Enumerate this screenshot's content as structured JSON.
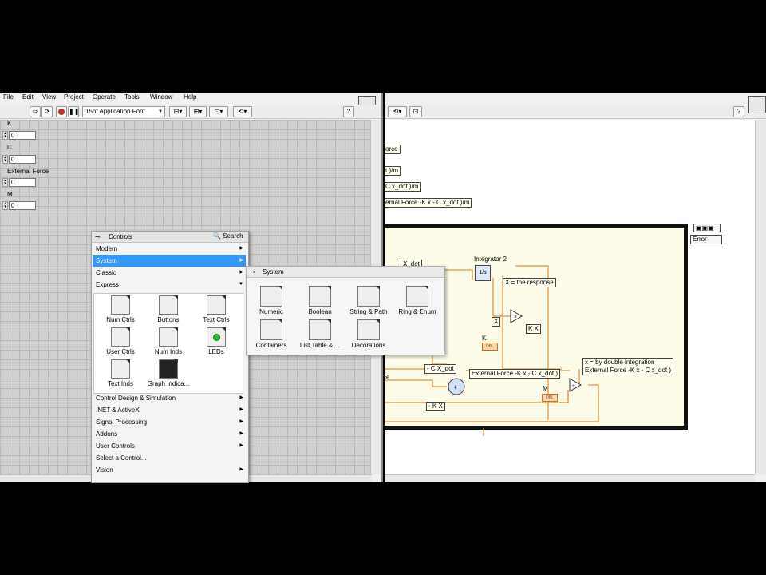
{
  "front_panel": {
    "menu": [
      "File",
      "Edit",
      "View",
      "Project",
      "Operate",
      "Tools",
      "Window",
      "Help"
    ],
    "font_selector": "15pt Application Font",
    "controls": [
      {
        "label": "K",
        "value": "0"
      },
      {
        "label": "C",
        "value": "0"
      },
      {
        "label": "External Force",
        "value": "0"
      },
      {
        "label": "M",
        "value": "0"
      }
    ]
  },
  "block_diagram": {
    "labels": {
      "force_frag": "orce",
      "ratio_frag": "t )/m",
      "cxdot_frag": "C x_dot )/m",
      "ext_force_m": "ernal Force -K x - C x_dot )/m",
      "integrator": "Integrator 2",
      "integrator_sym": "1/s",
      "x_dot": "X_dot",
      "x_response": "X = the response",
      "x": "X",
      "kx_out": "K X",
      "k": "K",
      "c_xdot": "- C X_dot",
      "ext_force_full": "External Force -K x - C x_dot )",
      "m": "M",
      "neg_kx": "- K X",
      "double_int_1": "x =  by double integration",
      "double_int_2": "External Force -K x - C x_dot )",
      "ce": "ce",
      "error": "Error",
      "const_dbl": "DBL"
    }
  },
  "controls_palette": {
    "title": "Controls",
    "search": "Search",
    "categories_top": [
      "Modern",
      "System",
      "Classic",
      "Express"
    ],
    "selected": "System",
    "express_items": [
      "Num Ctrls",
      "Buttons",
      "Text Ctrls",
      "User Ctrls",
      "Num Inds",
      "LEDs",
      "Text Inds",
      "Graph Indica..."
    ],
    "categories_bottom": [
      "Control Design & Simulation",
      ".NET & ActiveX",
      "Signal Processing",
      "Addons",
      "User Controls",
      "Select a Control...",
      "Vision"
    ]
  },
  "system_palette": {
    "title": "System",
    "items": [
      "Numeric",
      "Boolean",
      "String & Path",
      "Ring & Enum",
      "Containers",
      "List,Table & ...",
      "Decorations"
    ]
  },
  "colors": {
    "selection": "#3399ff",
    "wire": "#e8913c",
    "frame": "#111111"
  }
}
